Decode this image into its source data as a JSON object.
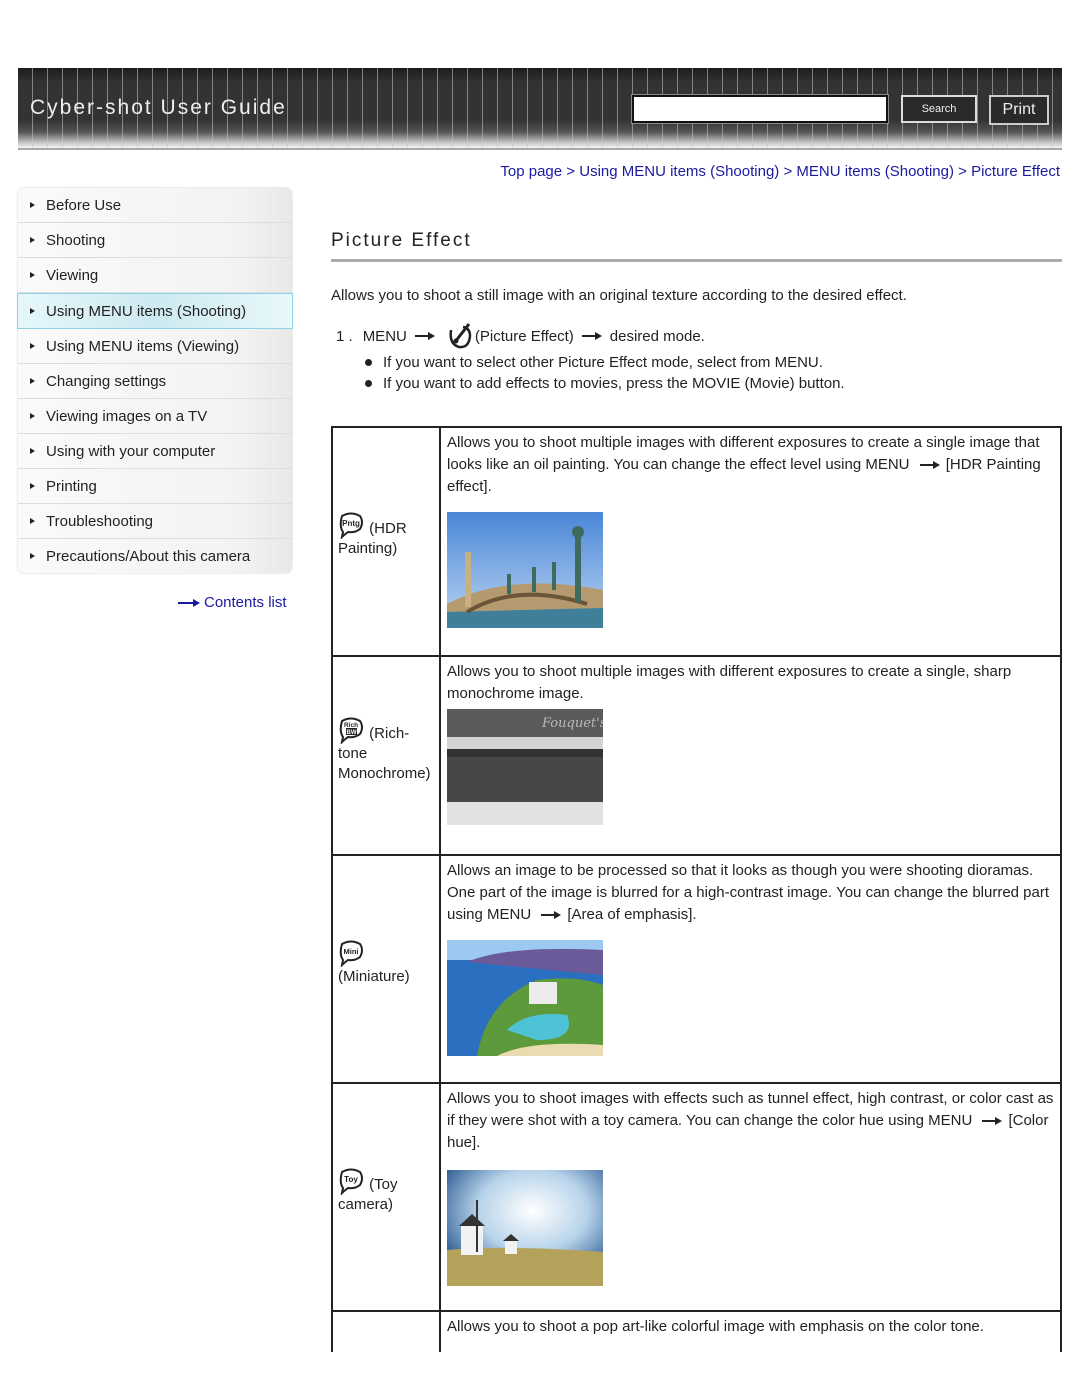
{
  "header": {
    "title": "Cyber-shot User Guide",
    "search_placeholder": "",
    "search_label": "Search",
    "print_label": "Print"
  },
  "breadcrumb": {
    "items": [
      "Top page",
      "Using MENU items (Shooting)",
      "MENU items (Shooting)",
      "Picture Effect"
    ],
    "separator": ">"
  },
  "sidebar": {
    "items": [
      {
        "label": "Before Use",
        "active": false
      },
      {
        "label": "Shooting",
        "active": false
      },
      {
        "label": "Viewing",
        "active": false
      },
      {
        "label": "Using MENU items (Shooting)",
        "active": true
      },
      {
        "label": "Using MENU items (Viewing)",
        "active": false
      },
      {
        "label": "Changing settings",
        "active": false
      },
      {
        "label": "Viewing images on a TV",
        "active": false
      },
      {
        "label": "Using with your computer",
        "active": false
      },
      {
        "label": "Printing",
        "active": false
      },
      {
        "label": "Troubleshooting",
        "active": false
      },
      {
        "label": "Precautions/About this camera",
        "active": false
      }
    ],
    "contents_link": "Contents list"
  },
  "main": {
    "title": "Picture Effect",
    "intro": "Allows you to shoot a still image with an original texture according to the desired effect.",
    "step": {
      "number": "1 .",
      "menu": "MENU",
      "picture_effect": "(Picture Effect)",
      "end": "desired mode."
    },
    "bullets": [
      "If you want to select other Picture Effect mode, select from MENU.",
      "If you want to add effects to movies, press the MOVIE (Movie) button."
    ],
    "modes": [
      {
        "icon": "Pntg",
        "name_line1": " (HDR",
        "name_rest": "Painting)",
        "desc_parts": [
          "Allows you to shoot multiple images with different exposures to create a single image that looks like an oil painting. You can change the effect level using MENU",
          "[HDR Painting effect]."
        ],
        "image": "bridge-photo"
      },
      {
        "icon": "Rich BW",
        "name_line1": " (Rich-",
        "name_rest": "tone Monochrome)",
        "desc_parts": [
          "Allows you to shoot multiple images with different exposures to create a single, sharp monochrome image."
        ],
        "image": "cafe-photo"
      },
      {
        "icon": "Mini",
        "name_line1": "",
        "name_rest": "(Miniature)",
        "desc_parts": [
          "Allows an image to be processed so that it looks as though you were shooting dioramas. One part of the image is blurred for a high-contrast image. You can change the blurred part using MENU",
          "[Area of emphasis]."
        ],
        "image": "coast-photo"
      },
      {
        "icon": "Toy",
        "name_line1": " (Toy",
        "name_rest": "camera)",
        "desc_parts": [
          "Allows you to shoot images with effects such as tunnel effect, high contrast, or color cast as if they were shot with a toy camera. You can change the color hue using MENU",
          "[Color hue]."
        ],
        "image": "windmill-photo"
      },
      {
        "icon": "",
        "name_line1": "",
        "name_rest": "",
        "desc_parts": [
          "Allows you to shoot a pop art-like colorful image with emphasis on the color tone."
        ],
        "image": ""
      }
    ]
  },
  "colors": {
    "link": "#1a1aa0",
    "header_bg": "#333333",
    "active_item_bg": "#cdeaf0"
  }
}
